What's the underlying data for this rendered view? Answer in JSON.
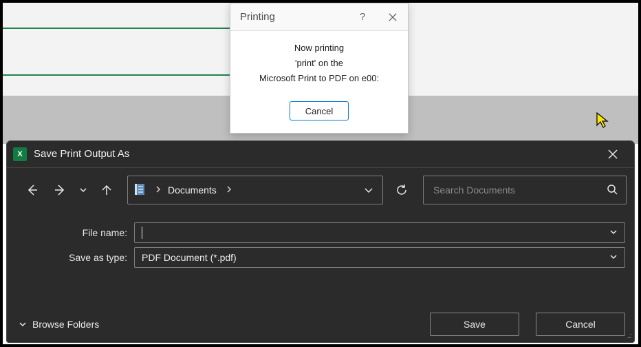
{
  "printing": {
    "title": "Printing",
    "line1": "Now printing",
    "line2": "'print' on the",
    "line3": "Microsoft Print to PDF on e00:",
    "cancel": "Cancel"
  },
  "save": {
    "title": "Save Print Output As",
    "breadcrumb": "Documents",
    "search_placeholder": "Search Documents",
    "file_name_label": "File name:",
    "file_name_value": "",
    "save_as_type_label": "Save as type:",
    "save_as_type_value": "PDF Document (*.pdf)",
    "browse_folders": "Browse Folders",
    "save_btn": "Save",
    "cancel_btn": "Cancel"
  }
}
